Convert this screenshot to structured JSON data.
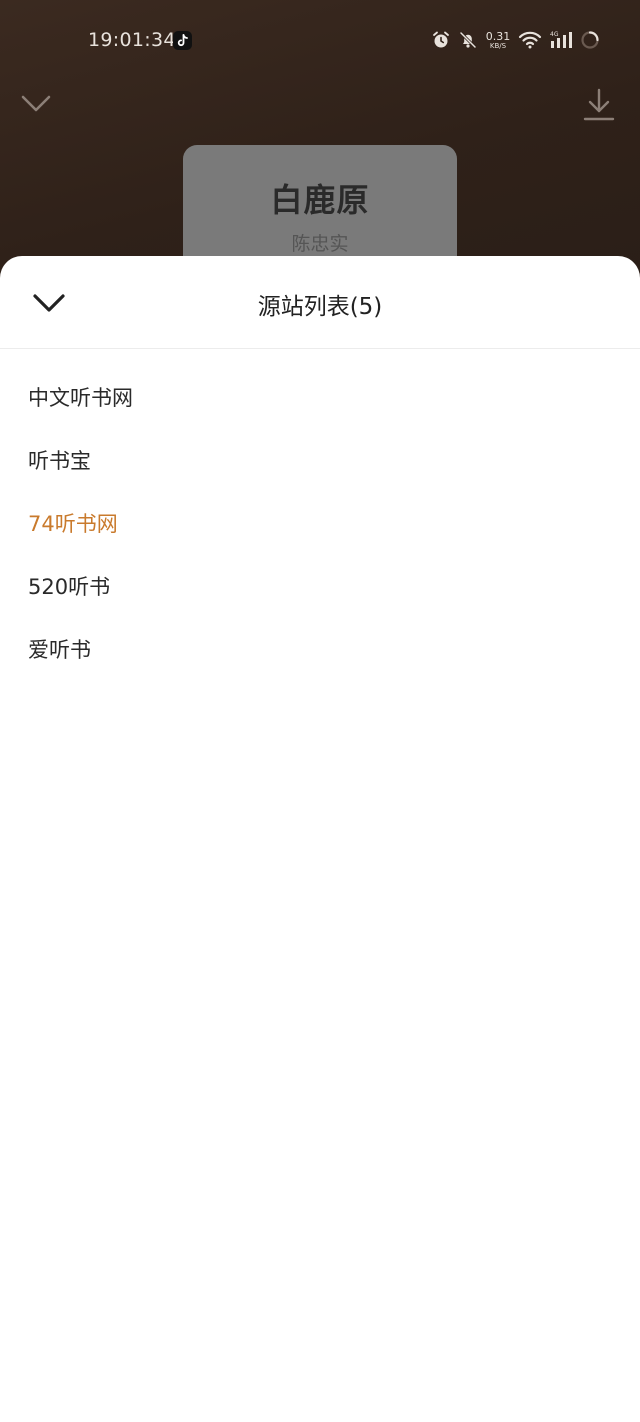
{
  "status_bar": {
    "time": "19:01:34",
    "net_speed_value": "0.31",
    "net_speed_unit": "KB/S",
    "network_type": "4G"
  },
  "player": {
    "book_title": "白鹿原",
    "author": "陈忠实"
  },
  "sheet": {
    "title": "源站列表(5)",
    "sources": [
      {
        "label": "中文听书网",
        "selected": false
      },
      {
        "label": "听书宝",
        "selected": false
      },
      {
        "label": "74听书网",
        "selected": true
      },
      {
        "label": "520听书",
        "selected": false
      },
      {
        "label": "爱听书",
        "selected": false
      }
    ]
  },
  "colors": {
    "accent": "#c97a2c",
    "background_dark": "#2f2119",
    "text_primary": "#2a2a2a"
  },
  "icons": {
    "collapse": "chevron-down-icon",
    "download": "download-icon",
    "alarm": "alarm-icon",
    "mute": "bell-off-icon",
    "wifi": "wifi-icon",
    "signal": "signal-icon",
    "loading": "loading-icon",
    "app": "tiktok-icon"
  }
}
